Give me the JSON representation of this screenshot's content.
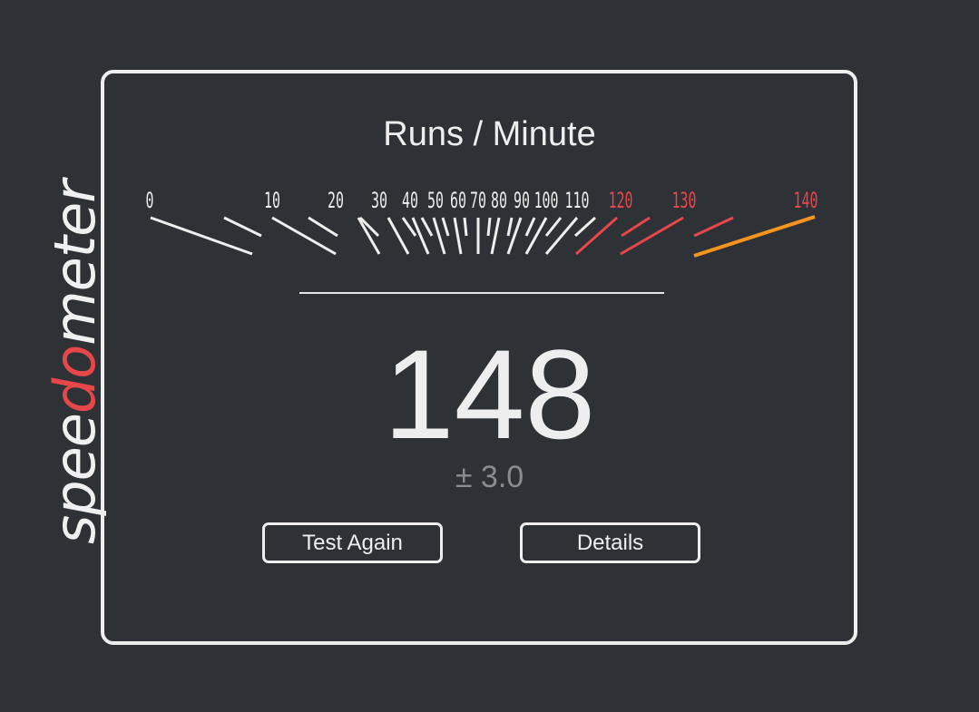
{
  "logo": {
    "part1": "spee",
    "part2": "do",
    "part3": "meter"
  },
  "gauge": {
    "title": "Runs / Minute",
    "min": 0,
    "max": 140,
    "value": 148,
    "tick_labels": [
      {
        "text": "0",
        "color": "white"
      },
      {
        "text": "10",
        "color": "white"
      },
      {
        "text": "20",
        "color": "white"
      },
      {
        "text": "30",
        "color": "white"
      },
      {
        "text": "40",
        "color": "white"
      },
      {
        "text": "50",
        "color": "white"
      },
      {
        "text": "60",
        "color": "white"
      },
      {
        "text": "70",
        "color": "white"
      },
      {
        "text": "80",
        "color": "white"
      },
      {
        "text": "90",
        "color": "white"
      },
      {
        "text": "100",
        "color": "white"
      },
      {
        "text": "110",
        "color": "white"
      },
      {
        "text": "120",
        "color": "red"
      },
      {
        "text": "130",
        "color": "red"
      },
      {
        "text": "140",
        "color": "red"
      }
    ],
    "colors": {
      "white": "#eeeeee",
      "red": "#e8474a",
      "orange": "#f7941d"
    }
  },
  "result": {
    "score": "148",
    "deviation": "± 3.0"
  },
  "buttons": {
    "test_again": "Test Again",
    "details": "Details"
  }
}
